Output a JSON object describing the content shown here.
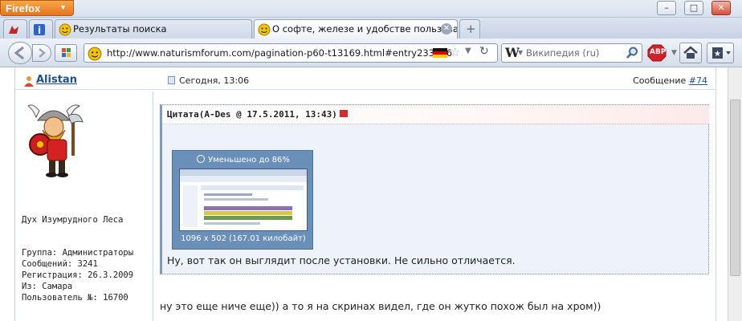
{
  "browser": {
    "app_button": "Firefox",
    "tabs": [
      {
        "label": "",
        "icon": "home-tab-icon"
      },
      {
        "label": "",
        "icon": "info-tab-icon"
      },
      {
        "label": "Результаты поиска",
        "icon": "smiley-favicon"
      },
      {
        "label": "О софте, железе и удобстве пользова...",
        "icon": "smiley-favicon",
        "active": true
      }
    ],
    "url": "http://www.naturismforum.com/pagination-p60-t13169.html#entry233896",
    "search_placeholder": "Википедия (ru)",
    "search_engine_letter": "W",
    "abp_label": "ABP"
  },
  "post": {
    "author": "Alistan",
    "date": "Сегодня, 13:06",
    "message_label": "Сообщение",
    "message_num": "#74",
    "rank": "Дух Изумрудного Леса",
    "info": [
      "Группа: Администраторы",
      "Сообщений: 3241",
      "Регистрация: 26.3.2009",
      "Из: Самара",
      "Пользователь №: 16700"
    ],
    "quote": {
      "header": "Цитата(A-Des @ 17.5.2011, 13:43)",
      "thumb_caption": "Уменьшено до 86%",
      "thumb_dims": "1096 x 502 (167.01 килобайт)",
      "text": "Ну, вот так он выглядит после установки. Не сильно отличается."
    },
    "reply": "ну это еще ниче еще)) а то я на скринах видел, где он жутко похож был на хром))"
  }
}
